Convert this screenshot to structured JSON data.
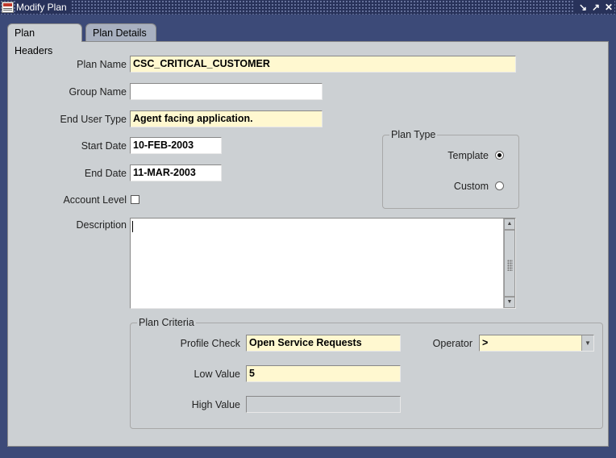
{
  "window": {
    "title": "Modify Plan"
  },
  "tabs": [
    {
      "label": "Plan Headers"
    },
    {
      "label": "Plan Details"
    }
  ],
  "form": {
    "plan_name": {
      "label": "Plan Name",
      "value": "CSC_CRITICAL_CUSTOMER"
    },
    "group_name": {
      "label": "Group Name",
      "value": ""
    },
    "end_user_type": {
      "label": "End User Type",
      "value": "Agent facing application."
    },
    "start_date": {
      "label": "Start Date",
      "value": "10-FEB-2003"
    },
    "end_date": {
      "label": "End Date",
      "value": "11-MAR-2003"
    },
    "account_level": {
      "label": "Account Level",
      "checked": false
    },
    "description": {
      "label": "Description",
      "value": ""
    }
  },
  "plan_type": {
    "title": "Plan Type",
    "options": [
      {
        "label": "Template",
        "selected": true
      },
      {
        "label": "Custom",
        "selected": false
      }
    ]
  },
  "plan_criteria": {
    "title": "Plan Criteria",
    "profile_check": {
      "label": "Profile Check",
      "value": "Open Service Requests"
    },
    "operator": {
      "label": "Operator",
      "value": ">"
    },
    "low_value": {
      "label": "Low Value",
      "value": "5"
    },
    "high_value": {
      "label": "High Value",
      "value": ""
    }
  }
}
